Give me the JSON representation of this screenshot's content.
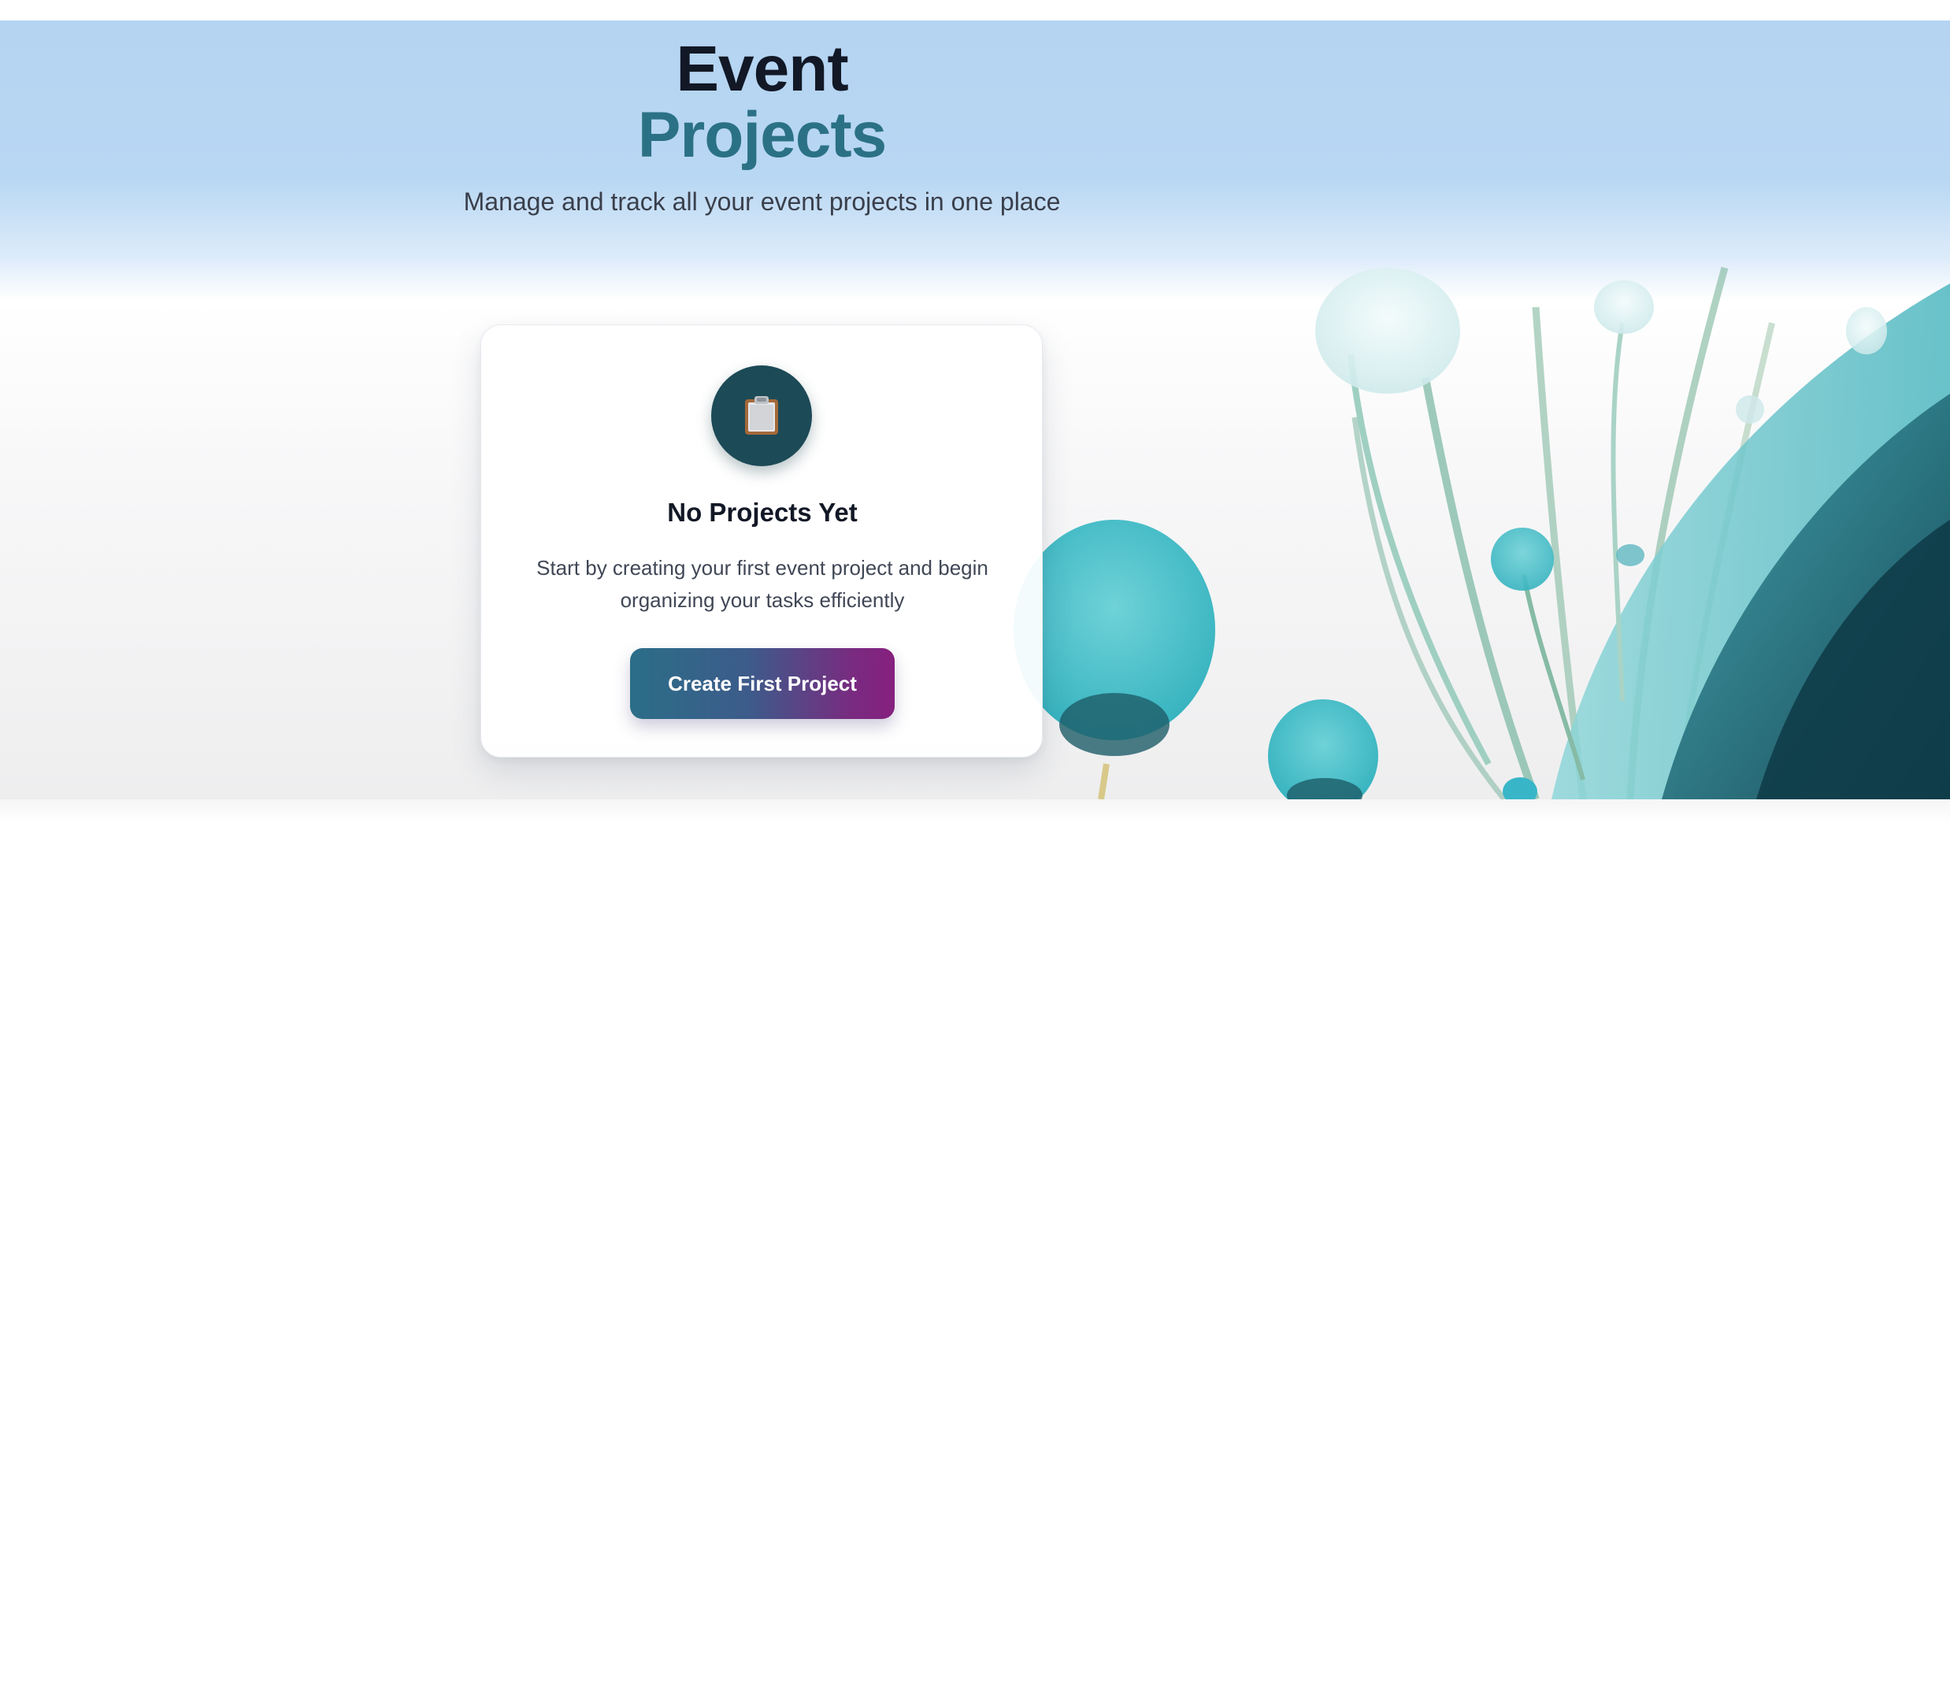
{
  "header": {
    "title_line1": "Event",
    "title_line2": "Projects",
    "subtitle": "Manage and track all your event projects in one place"
  },
  "empty_state": {
    "icon": "clipboard-icon",
    "title": "No Projects Yet",
    "description": "Start by creating your first event project and begin organizing your tasks efficiently",
    "button_label": "Create First Project"
  },
  "colors": {
    "hero_top": "#b4d4f2",
    "title_dark": "#121826",
    "title_accent": "#2b7185",
    "icon_circle": "#1c4a56",
    "button_gradient_start": "#2b6e88",
    "button_gradient_end": "#86207e"
  }
}
